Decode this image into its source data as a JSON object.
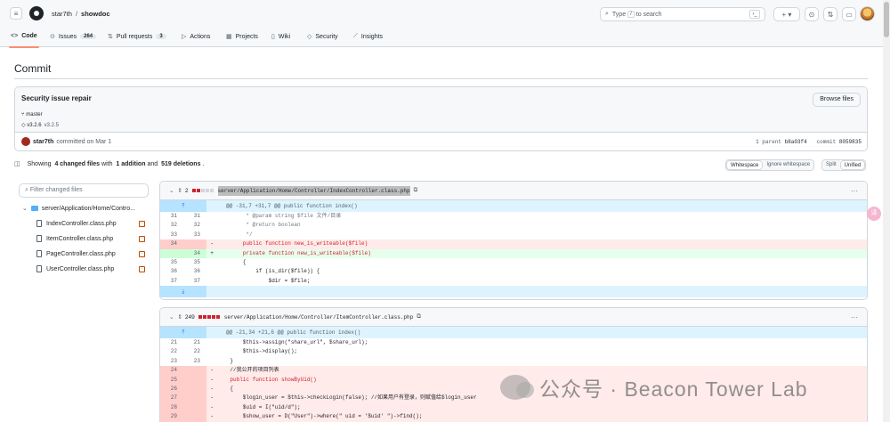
{
  "header": {
    "owner": "star7th",
    "repo": "showdoc",
    "search_prefix": "Type",
    "search_key": "/",
    "search_suffix": "to search"
  },
  "nav": [
    {
      "label": "Code",
      "icon": "code-icon",
      "active": true
    },
    {
      "label": "Issues",
      "icon": "issue-icon",
      "count": "264"
    },
    {
      "label": "Pull requests",
      "icon": "pull-request-icon",
      "count": "3"
    },
    {
      "label": "Actions",
      "icon": "play-icon"
    },
    {
      "label": "Projects",
      "icon": "table-icon"
    },
    {
      "label": "Wiki",
      "icon": "book-icon"
    },
    {
      "label": "Security",
      "icon": "shield-icon"
    },
    {
      "label": "Insights",
      "icon": "graph-icon"
    }
  ],
  "page": {
    "title": "Commit"
  },
  "commit": {
    "message": "Security issue repair",
    "browse_label": "Browse files",
    "branch": "master",
    "tag_primary": "v3.2.6",
    "tag_secondary": "v3.2.5",
    "author": "star7th",
    "committed_text": "committed on Mar 1",
    "parent_label": "1 parent",
    "parent_sha": "b8a03f4",
    "commit_label": "commit",
    "commit_sha": "8059835"
  },
  "summary": {
    "prefix": "Showing",
    "files_changed": "4 changed files",
    "with": "with",
    "additions": "1 addition",
    "and": "and",
    "deletions": "519 deletions",
    "period": "."
  },
  "view_options": {
    "whitespace": "Whitespace",
    "ignore_whitespace": "Ignore whitespace",
    "split": "Split",
    "unified": "Unified"
  },
  "file_tree": {
    "filter_placeholder": "Filter changed files",
    "directory": "server/Application/Home/Contro...",
    "files": [
      "IndexController.class.php",
      "ItemController.class.php",
      "PageController.class.php",
      "UserController.class.php"
    ]
  },
  "diffs": [
    {
      "count": "2",
      "path": "server/Application/Home/Controller/IndexController.class.php",
      "hunk": "@@ -31,7 +31,7 @@ public function index()",
      "lines": [
        {
          "type": "ctx",
          "old": "31",
          "new": "31",
          "sign": "",
          "code": "         * @param string $file 文件/目录"
        },
        {
          "type": "ctx",
          "old": "32",
          "new": "32",
          "sign": "",
          "code": "         * @return boolean"
        },
        {
          "type": "ctx",
          "old": "33",
          "new": "33",
          "sign": "",
          "code": "         */"
        },
        {
          "type": "del",
          "old": "34",
          "new": "",
          "sign": "-",
          "code": "        public function new_is_writeable($file)"
        },
        {
          "type": "add",
          "old": "",
          "new": "34",
          "sign": "+",
          "code": "        private function new_is_writeable($file)"
        },
        {
          "type": "ctx",
          "old": "35",
          "new": "35",
          "sign": "",
          "code": "        {"
        },
        {
          "type": "ctx",
          "old": "36",
          "new": "36",
          "sign": "",
          "code": "            if (is_dir($file)) {"
        },
        {
          "type": "ctx",
          "old": "37",
          "new": "37",
          "sign": "",
          "code": "                $dir = $file;"
        }
      ]
    },
    {
      "count": "249",
      "path": "server/Application/Home/Controller/ItemController.class.php",
      "hunk": "@@ -21,34 +21,6 @@ public function index()",
      "lines": [
        {
          "type": "ctx",
          "old": "21",
          "new": "21",
          "sign": "",
          "code": "        $this->assign(\"share_url\", $share_url);"
        },
        {
          "type": "ctx",
          "old": "22",
          "new": "22",
          "sign": "",
          "code": "        $this->display();"
        },
        {
          "type": "ctx",
          "old": "23",
          "new": "23",
          "sign": "",
          "code": "    }"
        },
        {
          "type": "del",
          "old": "24",
          "new": "",
          "sign": "-",
          "code": "    //我公开的项目列表"
        },
        {
          "type": "del",
          "old": "25",
          "new": "",
          "sign": "-",
          "code": "    public function showByUid()"
        },
        {
          "type": "del",
          "old": "26",
          "new": "",
          "sign": "-",
          "code": "    {"
        },
        {
          "type": "del",
          "old": "27",
          "new": "",
          "sign": "-",
          "code": "        $login_user = $this->checkLogin(false); //如果用户有登录，则赋值给$login_user"
        },
        {
          "type": "del",
          "old": "28",
          "new": "",
          "sign": "-",
          "code": "        $uid = I(\"uid/d\");"
        },
        {
          "type": "del",
          "old": "29",
          "new": "",
          "sign": "-",
          "code": "        $show_user = D(\"User\")->where(\" uid = '$uid' \")->find();"
        }
      ]
    }
  ],
  "watermark": "公众号 · Beacon Tower Lab",
  "colors": {
    "accent": "#fd8c73",
    "deletion": "#cf222e",
    "addition": "#1a7f37",
    "link": "#0969da"
  }
}
